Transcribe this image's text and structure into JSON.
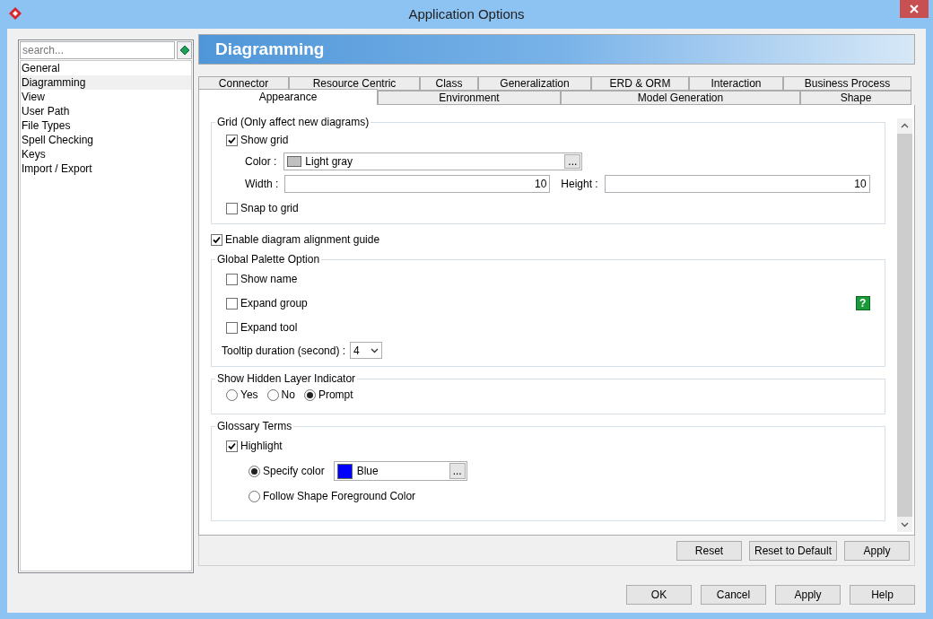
{
  "window": {
    "title": "Application Options"
  },
  "sidebar": {
    "search": {
      "placeholder": "search..."
    },
    "items": [
      {
        "label": "General",
        "selected": false
      },
      {
        "label": "Diagramming",
        "selected": true
      },
      {
        "label": "View",
        "selected": false
      },
      {
        "label": "User Path",
        "selected": false
      },
      {
        "label": "File Types",
        "selected": false
      },
      {
        "label": "Spell Checking",
        "selected": false
      },
      {
        "label": "Keys",
        "selected": false
      },
      {
        "label": "Import / Export",
        "selected": false
      }
    ]
  },
  "panel": {
    "title": "Diagramming",
    "tab_rows": [
      [
        {
          "label": "Connector",
          "selected": false
        },
        {
          "label": "Resource Centric",
          "selected": false
        },
        {
          "label": "Class",
          "selected": false
        },
        {
          "label": "Generalization",
          "selected": false
        },
        {
          "label": "ERD & ORM",
          "selected": false
        },
        {
          "label": "Interaction",
          "selected": false
        },
        {
          "label": "Business Process",
          "selected": false
        }
      ],
      [
        {
          "label": "Appearance",
          "selected": true
        },
        {
          "label": "Environment",
          "selected": false
        },
        {
          "label": "Model Generation",
          "selected": false
        },
        {
          "label": "Shape",
          "selected": false
        }
      ]
    ],
    "grid": {
      "title": "Grid (Only affect new diagrams)",
      "show_grid": {
        "label": "Show grid",
        "checked": true
      },
      "color": {
        "label": "Color :",
        "value": "Light gray",
        "color": "#c0c0c0",
        "button": "..."
      },
      "width": {
        "label": "Width :",
        "value": "10"
      },
      "height": {
        "label": "Height :",
        "value": "10"
      },
      "snap": {
        "label": "Snap to grid",
        "checked": false
      }
    },
    "alignment_guide": {
      "label": "Enable diagram alignment guide",
      "checked": true
    },
    "palette": {
      "title": "Global Palette Option",
      "options": [
        {
          "label": "Show name",
          "checked": false
        },
        {
          "label": "Expand group",
          "checked": false
        },
        {
          "label": "Expand tool",
          "checked": false
        }
      ],
      "help": "?",
      "tooltip": {
        "label": "Tooltip duration (second) :",
        "value": "4"
      }
    },
    "hidden_layer": {
      "title": "Show Hidden Layer Indicator",
      "options": [
        {
          "label": "Yes",
          "selected": false
        },
        {
          "label": "No",
          "selected": false
        },
        {
          "label": "Prompt",
          "selected": true
        }
      ]
    },
    "glossary": {
      "title": "Glossary Terms",
      "highlight": {
        "label": "Highlight",
        "checked": true
      },
      "options": [
        {
          "kind": "color",
          "label": "Specify color",
          "selected": true,
          "value": "Blue",
          "color": "#0000ff",
          "button": "..."
        },
        {
          "kind": "plain",
          "label": "Follow Shape Foreground Color",
          "selected": false
        }
      ]
    },
    "buttons": [
      "Reset",
      "Reset to Default",
      "Apply"
    ]
  },
  "dialog_buttons": [
    "OK",
    "Cancel",
    "Apply",
    "Help"
  ]
}
